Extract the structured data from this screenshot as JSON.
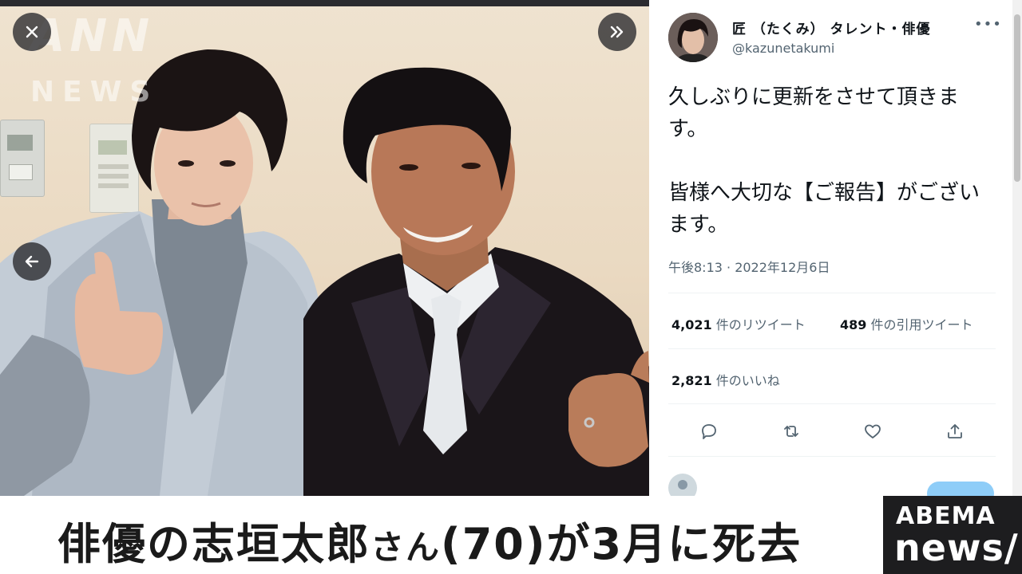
{
  "photo": {
    "watermark_line1": "ANN",
    "watermark_line2": "NEWS",
    "controls": {
      "close_icon": "close-icon",
      "next_icon": "double-chevron-right-icon",
      "back_icon": "arrow-left-icon"
    }
  },
  "tweet": {
    "display_name": "匠 （たくみ） タレント・俳優",
    "handle": "@kazunetakumi",
    "more_label": "•••",
    "body": "久しぶりに更新をさせて頂きます。\n\n皆様へ大切な【ご報告】がございます。",
    "timestamp": "午後8:13 · 2022年12月6日",
    "stats": {
      "retweets_count": "4,021",
      "retweets_label": "件のリツイート",
      "quotes_count": "489",
      "quotes_label": "件の引用ツイート",
      "likes_count": "2,821",
      "likes_label": "件のいいね"
    },
    "actions": [
      "reply-icon",
      "retweet-icon",
      "like-icon",
      "share-icon"
    ]
  },
  "caption": {
    "part1": "俳優の志垣太郎",
    "part2": "さん",
    "part3": "(70)が3月に死去"
  },
  "logo": {
    "line1": "ABEMA",
    "line2": "news/"
  },
  "colors": {
    "text_primary": "#0f1419",
    "text_secondary": "#536471",
    "caption_bg": "#ffffff",
    "logo_bg": "#1d1d1f"
  }
}
